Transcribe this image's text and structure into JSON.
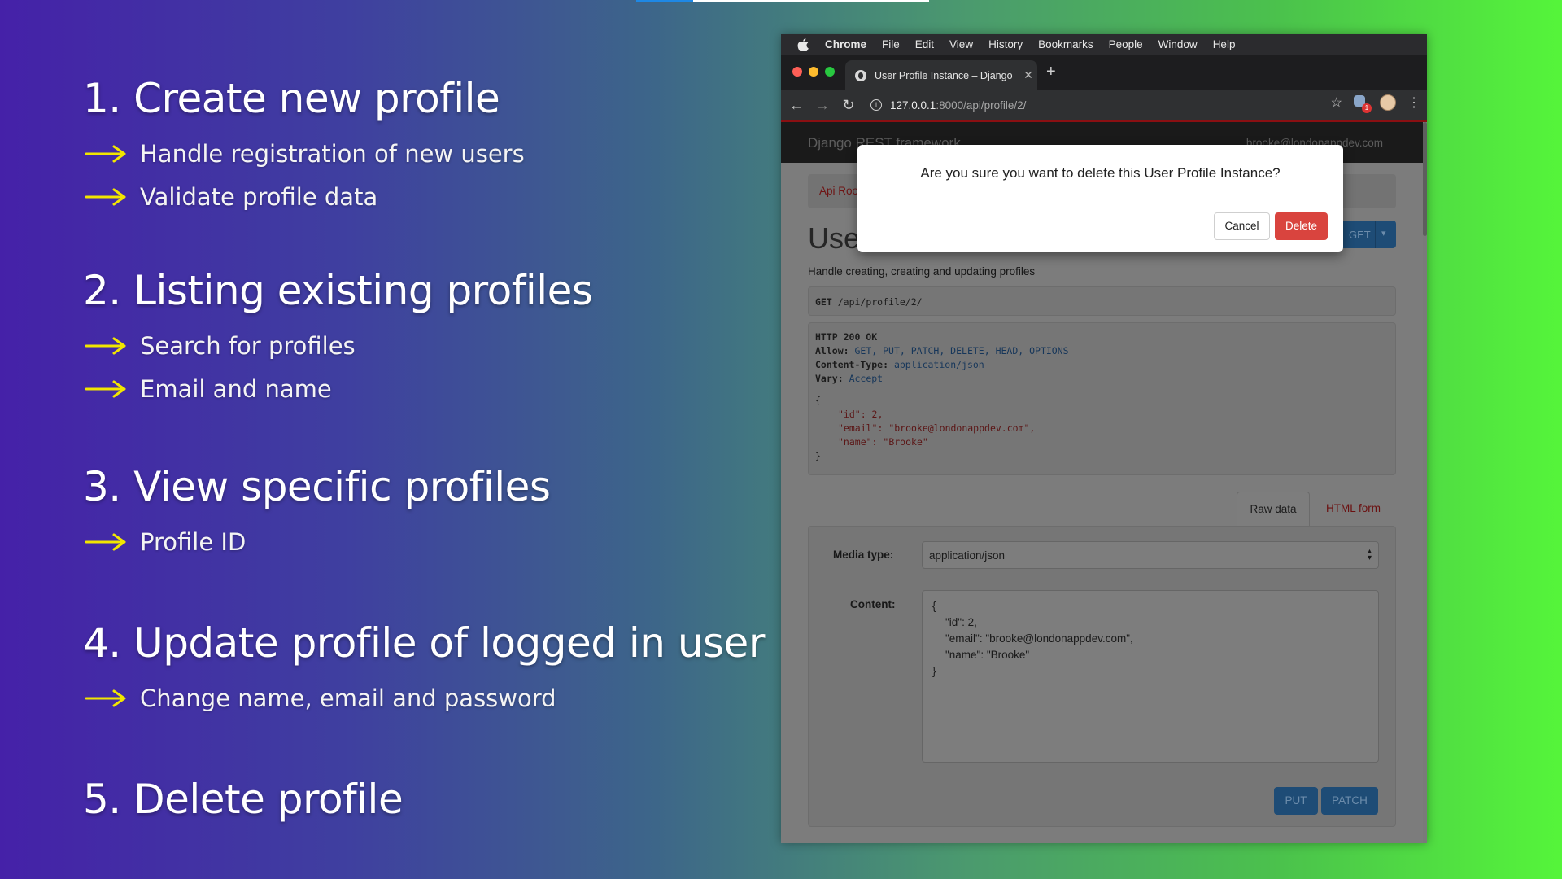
{
  "slide": {
    "sections": [
      {
        "title": "1. Create new profile",
        "bullets": [
          "Handle registration of new users",
          "Validate profile data"
        ]
      },
      {
        "title": "2. Listing existing profiles",
        "bullets": [
          "Search for profiles",
          "Email and name"
        ]
      },
      {
        "title": "3. View specific profiles",
        "bullets": [
          "Profile ID"
        ]
      },
      {
        "title": "4. Update profile of logged in user",
        "bullets": [
          "Change name, email and password"
        ]
      },
      {
        "title": "5. Delete profile",
        "bullets": []
      }
    ],
    "arrow_color": "#f2e600"
  },
  "menubar": {
    "items": [
      "Chrome",
      "File",
      "Edit",
      "View",
      "History",
      "Bookmarks",
      "People",
      "Window",
      "Help"
    ]
  },
  "browser": {
    "tab_title": "User Profile Instance – Django",
    "url_host": "127.0.0.1",
    "url_path": ":8000/api/profile/2/",
    "extension_badge": "1"
  },
  "drf": {
    "brand": "Django REST framework",
    "user": "brooke@londonappdev.com",
    "breadcrumb": "Api Root",
    "page_title": "User Profile Instance",
    "get_label": "GET",
    "description": "Handle creating, creating and updating profiles",
    "request_method": "GET",
    "request_path": "/api/profile/2/",
    "response": {
      "status": "HTTP 200 OK",
      "allow_key": "Allow:",
      "allow": "GET, PUT, PATCH, DELETE, HEAD, OPTIONS",
      "ctype_key": "Content-Type:",
      "ctype": "application/json",
      "vary_key": "Vary:",
      "vary": "Accept",
      "open": "{",
      "id_line": "\"id\": 2,",
      "email_key": "\"email\":",
      "email_val": "\"brooke@londonappdev.com\",",
      "name_key": "\"name\":",
      "name_val": "\"Brooke\"",
      "close": "}"
    },
    "tabs": {
      "raw": "Raw data",
      "html": "HTML form"
    },
    "form": {
      "media_label": "Media type:",
      "media_value": "application/json",
      "content_label": "Content:",
      "content_lines": [
        "{",
        "\"id\": 2,",
        "\"email\": \"brooke@londonappdev.com\",",
        "\"name\": \"Brooke\"",
        "}"
      ],
      "put": "PUT",
      "patch": "PATCH"
    }
  },
  "modal": {
    "question": "Are you sure you want to delete this User Profile Instance?",
    "cancel": "Cancel",
    "delete": "Delete",
    "delete_color": "#d9443e"
  }
}
